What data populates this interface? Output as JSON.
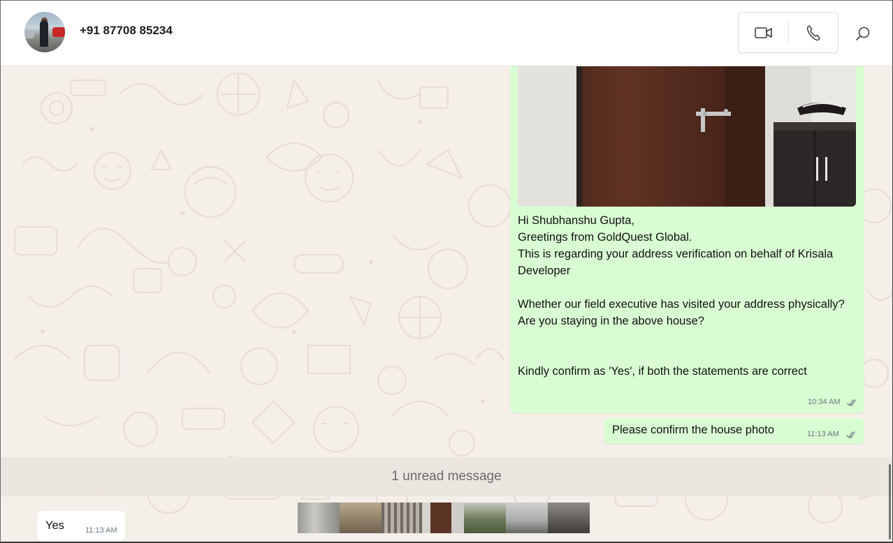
{
  "contact": {
    "name": "+91 87708 85234"
  },
  "header_icons": {
    "video": "video-call-icon",
    "phone": "voice-call-icon",
    "search": "search-icon"
  },
  "messages": {
    "image_message": {
      "text": "Hi Shubhanshu Gupta,\nGreetings from GoldQuest Global.\nThis is regarding your address verification on behalf of Krisala Developer\n\nWhether our field executive has visited your address physically?\nAre you staying in the above house?\n\n\nKindly confirm as 'Yes', if both the statements are correct",
      "time": "10:34 AM",
      "status": "read"
    },
    "confirm_message": {
      "text": "Please confirm the house photo",
      "time": "11:13 AM",
      "status": "read"
    },
    "unread_divider": "1 unread message",
    "incoming": {
      "text": "Yes",
      "time": "11:13 AM"
    }
  },
  "colors": {
    "outgoing_bubble": "#d9fdd3",
    "incoming_bubble": "#ffffff",
    "chat_background": "#f4efe9",
    "tick_color": "#667781"
  }
}
